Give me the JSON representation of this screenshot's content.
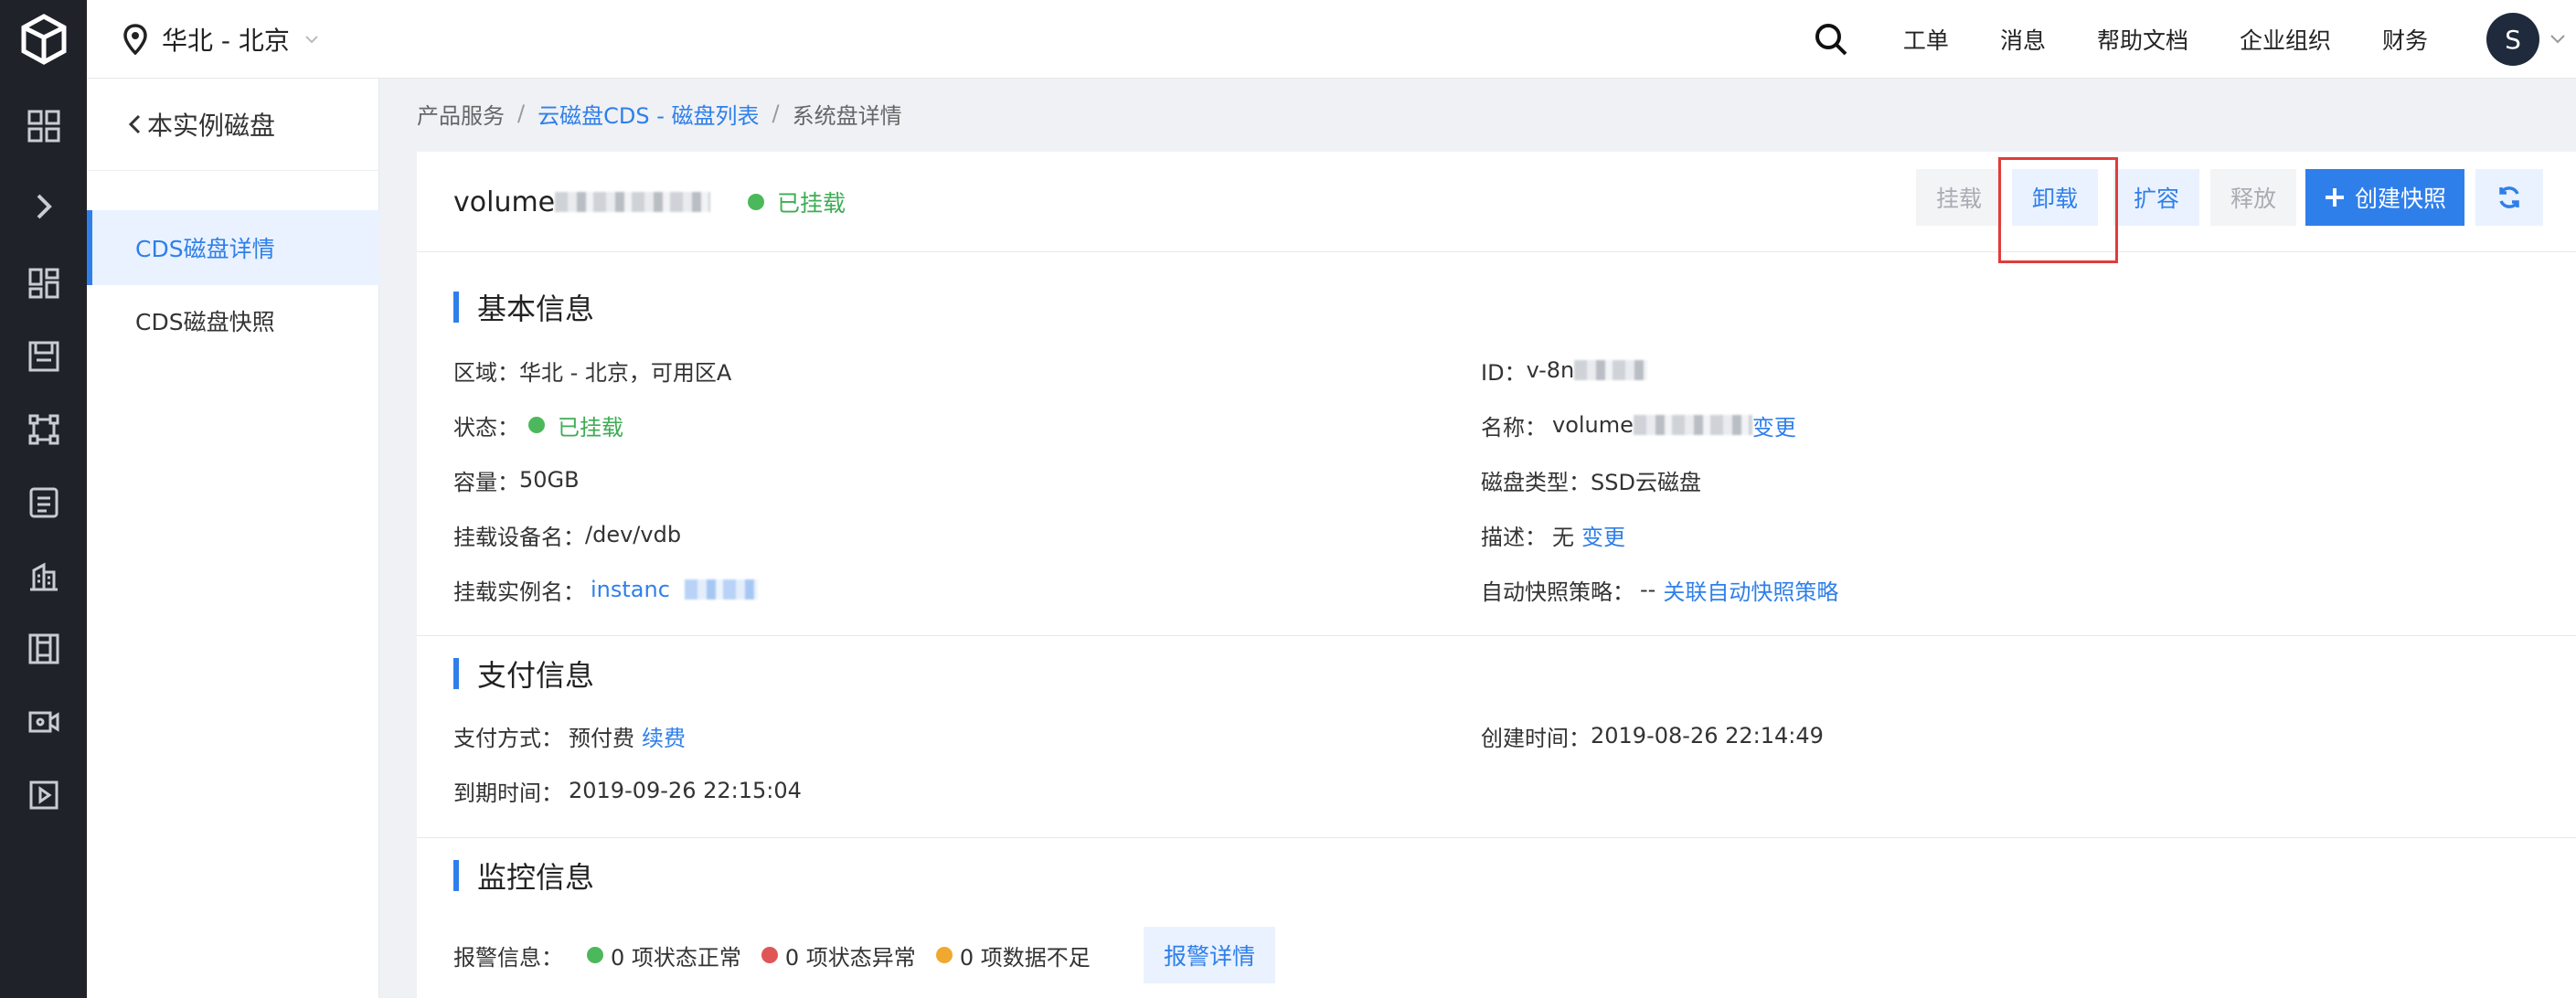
{
  "topbar": {
    "region": "华北 - 北京",
    "nav": [
      "工单",
      "消息",
      "帮助文档",
      "企业组织",
      "财务"
    ],
    "avatar": "S"
  },
  "sidebar": {
    "back_label": "本实例磁盘",
    "items": [
      {
        "label": "CDS磁盘详情",
        "active": true
      },
      {
        "label": "CDS磁盘快照",
        "active": false
      }
    ]
  },
  "breadcrumb": {
    "root": "产品服务",
    "sep": "/",
    "link": "云磁盘CDS - 磁盘列表",
    "current": "系统盘详情"
  },
  "disk": {
    "name_prefix": "volume",
    "status": "已挂载"
  },
  "actions": {
    "attach": "挂载",
    "detach": "卸载",
    "expand": "扩容",
    "release": "释放",
    "snapshot": "创建快照",
    "refresh_icon": "refresh-icon"
  },
  "basic": {
    "title": "基本信息",
    "region_label": "区域：",
    "region_value": "华北 - 北京，可用区A",
    "status_label": "状态：",
    "status_value": "已挂载",
    "capacity_label": "容量：",
    "capacity_value": "50GB",
    "device_label": "挂载设备名：",
    "device_value": "/dev/vdb",
    "instance_label": "挂载实例名：",
    "instance_value": "instanc",
    "id_label": "ID：",
    "id_value": "v-8n",
    "name_label": "名称：",
    "name_value": "volume",
    "name_change": "变更",
    "type_label": "磁盘类型：",
    "type_value": "SSD云磁盘",
    "desc_label": "描述：",
    "desc_value": "无",
    "desc_change": "变更",
    "snapshot_label": "自动快照策略：",
    "snapshot_value": "--",
    "snapshot_link": "关联自动快照策略"
  },
  "payment": {
    "title": "支付信息",
    "method_label": "支付方式：",
    "method_value": "预付费",
    "renew": "续费",
    "expire_label": "到期时间：",
    "expire_value": "2019-09-26 22:15:04",
    "created_label": "创建时间：",
    "created_value": "2019-08-26 22:14:49"
  },
  "monitor": {
    "title": "监控信息",
    "alarm_label": "报警信息：",
    "normal": "0 项状态正常",
    "abnormal": "0 项状态异常",
    "insufficient": "0 项数据不足",
    "detail_button": "报警详情"
  },
  "colors": {
    "accent": "#2f7fea",
    "success": "#4cb85c",
    "danger": "#e05656",
    "warning": "#f0a92f",
    "highlight": "#e23b3b"
  }
}
